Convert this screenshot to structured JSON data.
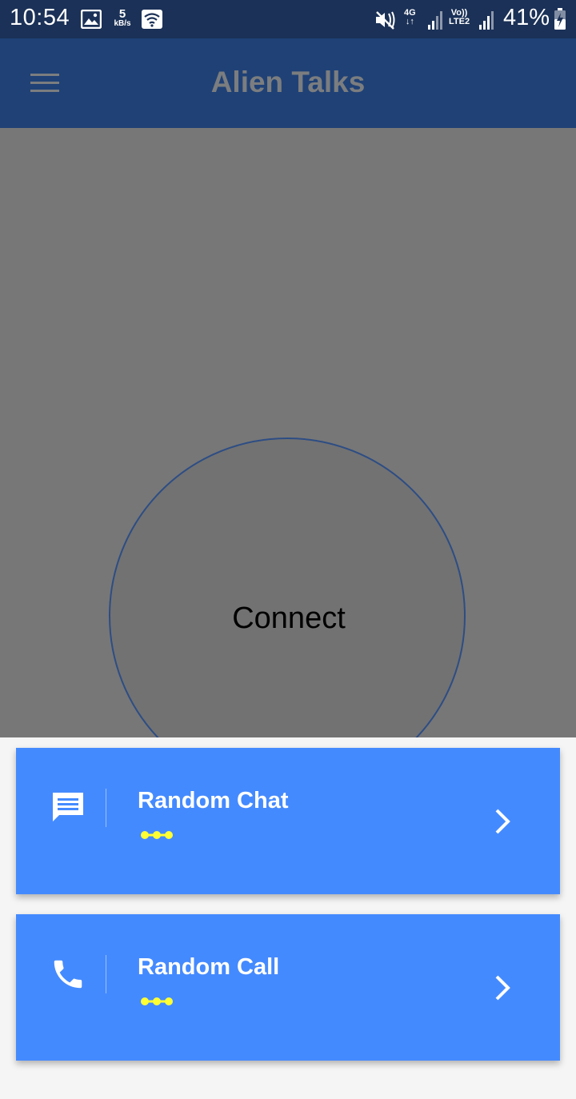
{
  "status_bar": {
    "time": "10:54",
    "speed_value": "5",
    "speed_unit": "kB/s",
    "net_4g": "4G",
    "volte_top": "Vo))",
    "volte_bottom": "LTE2",
    "battery_percent": "41%",
    "icons": [
      "gallery-icon",
      "wifi-icon",
      "mute-icon",
      "data-arrows-icon",
      "signal-icon",
      "signal-icon",
      "battery-charging-icon"
    ]
  },
  "app_bar": {
    "title": "Alien Talks",
    "menu_icon": "hamburger-menu-icon"
  },
  "connect": {
    "label": "Connect"
  },
  "cards": [
    {
      "title": "Random Chat",
      "icon": "chat-icon",
      "indicator_color": "#ffff33",
      "chevron": "chevron-right-icon"
    },
    {
      "title": "Random Call",
      "icon": "phone-icon",
      "indicator_color": "#ffff33",
      "chevron": "chevron-right-icon"
    }
  ],
  "colors": {
    "status_bar_bg": "#1b3157",
    "app_bar_bg": "#1f4176",
    "overlay_bg": "#777777",
    "card_bg": "#448aff",
    "indicator": "#ffff33",
    "circle_border": "#2d4d84"
  }
}
